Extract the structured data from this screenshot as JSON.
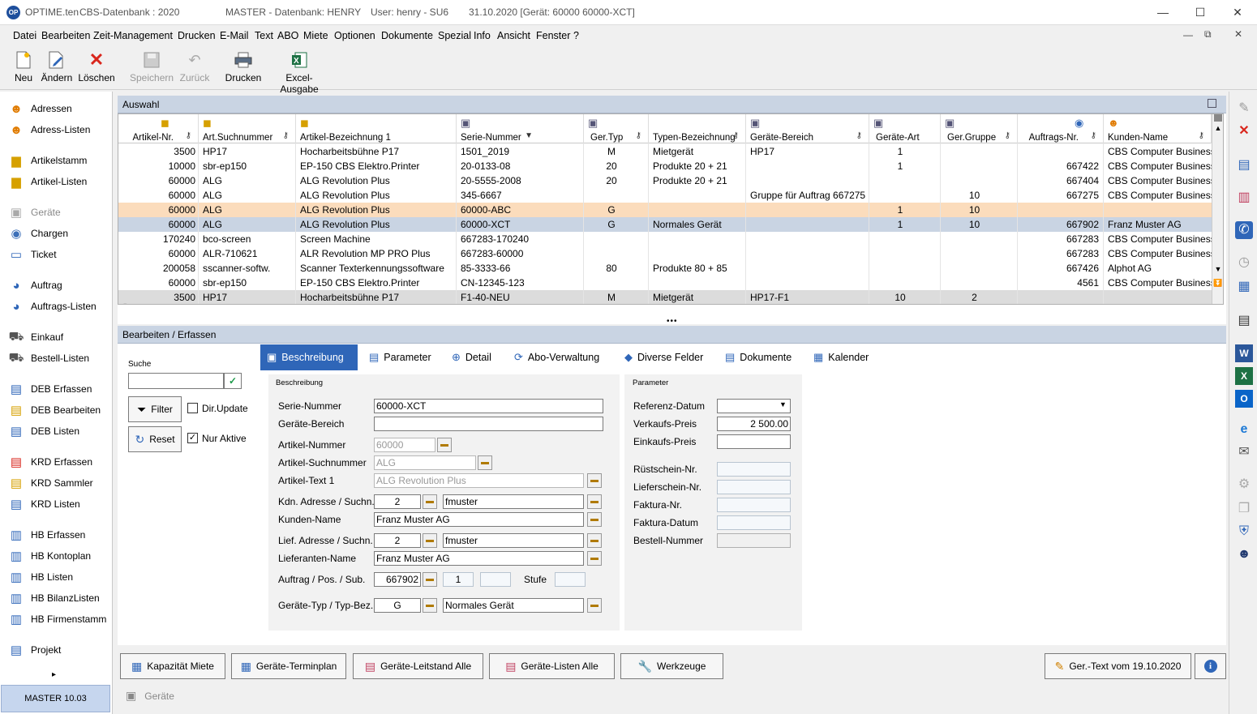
{
  "titlebar": {
    "logo": "OP",
    "app": "OPTIME.ten",
    "db": "CBS-Datenbank : 2020",
    "master": "MASTER - Datenbank:  HENRY",
    "user": "User:  henry  -  SU6",
    "date": "31.10.2020  [Gerät: 60000  60000-XCT]",
    "minimize": "—",
    "maximize": "☐",
    "close": "✕"
  },
  "menu": [
    "Datei",
    "Bearbeiten",
    "Zeit-Management",
    "Drucken",
    "E-Mail",
    "Text",
    "ABO",
    "Miete",
    "Optionen",
    "Dokumente",
    "Spezial",
    "Info",
    "Ansicht",
    "Fenster",
    "?"
  ],
  "toolbar": {
    "new": "Neu",
    "edit": "Ändern",
    "delete": "Löschen",
    "save": "Speichern",
    "back": "Zurück",
    "print": "Drucken",
    "excel": "Excel-Ausgabe"
  },
  "sidebar": [
    {
      "label": "Adressen",
      "icon": "people-icon"
    },
    {
      "label": "Adress-Listen",
      "icon": "people-list-icon"
    },
    {
      "label": "Artikelstamm",
      "icon": "box-icon"
    },
    {
      "label": "Artikel-Listen",
      "icon": "box-list-icon"
    },
    {
      "label": "Geräte",
      "icon": "device-icon"
    },
    {
      "label": "Chargen",
      "icon": "batch-icon"
    },
    {
      "label": "Ticket",
      "icon": "ticket-icon"
    },
    {
      "label": "Auftrag",
      "icon": "order-icon"
    },
    {
      "label": "Auftrags-Listen",
      "icon": "order-list-icon"
    },
    {
      "label": "Einkauf",
      "icon": "cart-icon"
    },
    {
      "label": "Bestell-Listen",
      "icon": "cart-list-icon"
    },
    {
      "label": "DEB Erfassen",
      "icon": "deb-icon"
    },
    {
      "label": "DEB Bearbeiten",
      "icon": "deb-edit-icon"
    },
    {
      "label": "DEB Listen",
      "icon": "deb-list-icon"
    },
    {
      "label": "KRD Erfassen",
      "icon": "krd-icon"
    },
    {
      "label": "KRD Sammler",
      "icon": "krd-collect-icon"
    },
    {
      "label": "KRD Listen",
      "icon": "krd-list-icon"
    },
    {
      "label": "HB Erfassen",
      "icon": "hb-icon"
    },
    {
      "label": "HB Kontoplan",
      "icon": "hb-plan-icon"
    },
    {
      "label": "HB Listen",
      "icon": "hb-list-icon"
    },
    {
      "label": "HB BilanzListen",
      "icon": "hb-balance-icon"
    },
    {
      "label": "HB Firmenstamm",
      "icon": "hb-company-icon"
    },
    {
      "label": "Projekt",
      "icon": "project-icon"
    }
  ],
  "sidebar_more": "▸",
  "status": "MASTER   10.03",
  "auswahl": {
    "title": "Auswahl",
    "columns": [
      "Artikel-Nr.",
      "Art.Suchnummer",
      "Artikel-Bezeichnung 1",
      "Serie-Nummer",
      "Ger.Typ",
      "Typen-Bezeichnung",
      "Geräte-Bereich",
      "Geräte-Art",
      "Ger.Gruppe",
      "Auftrags-Nr.",
      "Kunden-Name"
    ],
    "rows": [
      [
        "3500",
        "HP17",
        "Hocharbeitsbühne P17",
        "1501_2019",
        "M",
        "Mietgerät",
        "HP17",
        "1",
        "",
        "",
        "CBS Computer Business"
      ],
      [
        "10000",
        "sbr-ep150",
        "EP-150 CBS Elektro.Printer",
        "20-0133-08",
        "20",
        "Produkte 20 + 21",
        "",
        "1",
        "",
        "667422",
        "CBS Computer Business"
      ],
      [
        "60000",
        "ALG",
        "ALG Revolution Plus",
        "20-5555-2008",
        "20",
        "Produkte 20 + 21",
        "",
        "",
        "",
        "667404",
        "CBS Computer Business"
      ],
      [
        "60000",
        "ALG",
        "ALG Revolution Plus",
        "345-6667",
        "",
        "",
        "Gruppe für Auftrag 667275",
        "",
        "10",
        "667275",
        "CBS Computer Business"
      ],
      [
        "60000",
        "ALG",
        "ALG Revolution Plus",
        "60000-ABC",
        "G",
        "",
        "",
        "1",
        "10",
        "",
        ""
      ],
      [
        "60000",
        "ALG",
        "ALG Revolution Plus",
        "60000-XCT",
        "G",
        "Normales Gerät",
        "",
        "1",
        "10",
        "667902",
        "Franz Muster AG"
      ],
      [
        "170240",
        "bco-screen",
        "Screen Machine",
        "667283-170240",
        "",
        "",
        "",
        "",
        "",
        "667283",
        "CBS Computer Business"
      ],
      [
        "60000",
        "ALR-710621",
        "ALR Revolution MP PRO Plus",
        "667283-60000",
        "",
        "",
        "",
        "",
        "",
        "667283",
        "CBS Computer Business"
      ],
      [
        "200058",
        "sscanner-softw.",
        "Scanner Texterkennungssoftware",
        "85-3333-66",
        "80",
        "Produkte 80 + 85",
        "",
        "",
        "",
        "667426",
        "Alphot AG"
      ],
      [
        "60000",
        "sbr-ep150",
        "EP-150 CBS Elektro.Printer",
        "CN-12345-123",
        "",
        "",
        "",
        "",
        "",
        "4561",
        "CBS Computer Business"
      ],
      [
        "3500",
        "HP17",
        "Hocharbeitsbühne P17",
        "F1-40-NEU",
        "M",
        "Mietgerät",
        "HP17-F1",
        "10",
        "2",
        "",
        ""
      ]
    ]
  },
  "edit": {
    "title": "Bearbeiten / Erfassen",
    "suche_label": "Suche",
    "suche_value": "",
    "filter": "Filter",
    "reset": "Reset",
    "dirupdate": "Dir.Update",
    "nuraktive": "Nur Aktive",
    "tabs": [
      "Beschreibung",
      "Parameter",
      "Detail",
      "Abo-Verwaltung",
      "Diverse Felder",
      "Dokumente",
      "Kalender"
    ],
    "beschreibung": {
      "title": "Beschreibung",
      "serie_label": "Serie-Nummer",
      "serie": "60000-XCT",
      "bereich_label": "Geräte-Bereich",
      "bereich": "",
      "artnr_label": "Artikel-Nummer",
      "artnr": "60000",
      "suchnr_label": "Artikel-Suchnummer",
      "suchnr": "ALG",
      "arttext_label": "Artikel-Text 1",
      "arttext": "ALG Revolution Plus",
      "kdn_label": "Kdn. Adresse / Suchn.",
      "kdn_nr": "2",
      "kdn_such": "fmuster",
      "kname_label": "Kunden-Name",
      "kname": "Franz Muster AG",
      "lief_label": "Lief. Adresse / Suchn.",
      "lief_nr": "2",
      "lief_such": "fmuster",
      "lname_label": "Lieferanten-Name",
      "lname": "Franz Muster AG",
      "auftrag_label": "Auftrag / Pos. / Sub.",
      "auftrag": "667902",
      "pos": "1",
      "sub": "",
      "stufe_label": "Stufe",
      "stufe": "",
      "typ_label": "Geräte-Typ / Typ-Bez.",
      "typ": "G",
      "typbez": "Normales Gerät"
    },
    "parameter": {
      "title": "Parameter",
      "refdatum_label": "Referenz-Datum",
      "refdatum": "",
      "vk_label": "Verkaufs-Preis",
      "vk": "2 500.00",
      "ek_label": "Einkaufs-Preis",
      "ek": "",
      "ruest_label": "Rüstschein-Nr.",
      "ruest": "",
      "liefer_label": "Lieferschein-Nr.",
      "liefer": "",
      "faktnr_label": "Faktura-Nr.",
      "faktnr": "",
      "faktdat_label": "Faktura-Datum",
      "faktdat": "",
      "bestell_label": "Bestell-Nummer",
      "bestell": ""
    }
  },
  "bottom": {
    "kap": "Kapazität Miete",
    "termin": "Geräte-Terminplan",
    "leit": "Geräte-Leitstand Alle",
    "listen": "Geräte-Listen Alle",
    "werk": "Werkzeuge",
    "gertext": "Ger.-Text vom 19.10.2020",
    "info": "i",
    "geraete_tab": "Geräte"
  }
}
